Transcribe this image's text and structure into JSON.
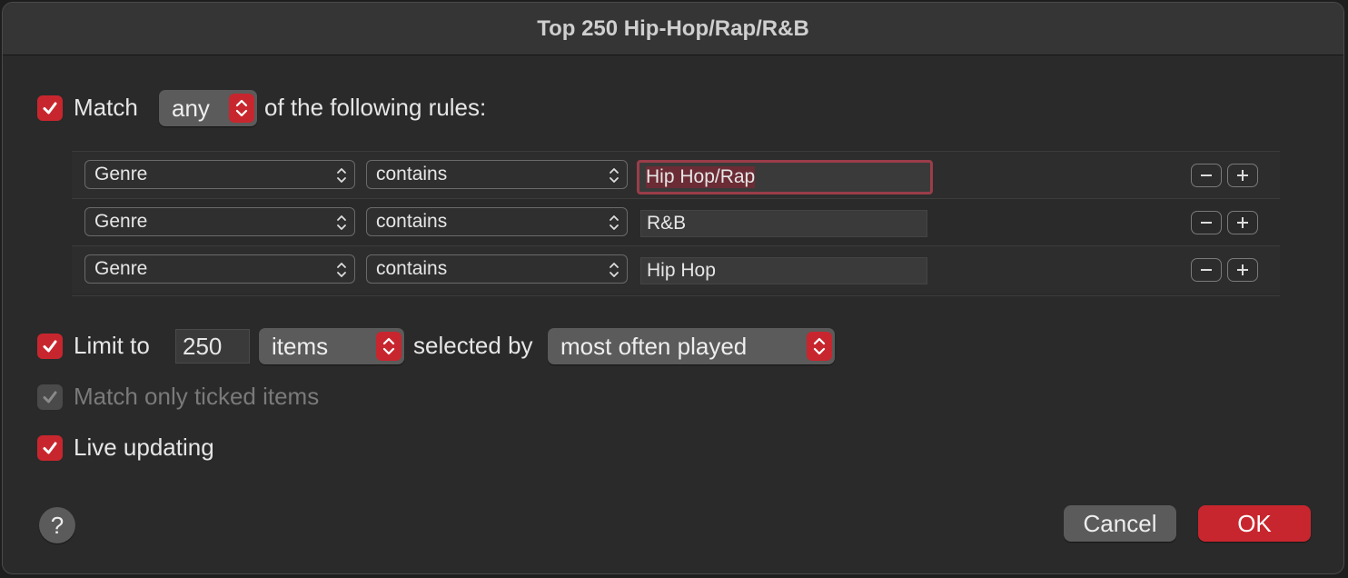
{
  "window": {
    "title": "Top 250 Hip-Hop/Rap/R&B"
  },
  "match": {
    "checked": true,
    "label": "Match",
    "mode": "any",
    "suffix": "of the following rules:"
  },
  "rules": [
    {
      "field": "Genre",
      "operator": "contains",
      "value": "Hip Hop/Rap",
      "focused": true
    },
    {
      "field": "Genre",
      "operator": "contains",
      "value": "R&B",
      "focused": false
    },
    {
      "field": "Genre",
      "operator": "contains",
      "value": "Hip Hop",
      "focused": false
    }
  ],
  "rule_buttons": {
    "remove": "−",
    "add": "+"
  },
  "limit": {
    "checked": true,
    "label": "Limit to",
    "count": "250",
    "unit": "items",
    "selected_by_label": "selected by",
    "selected_by": "most often played"
  },
  "match_ticked": {
    "checked": true,
    "enabled": false,
    "label": "Match only ticked items"
  },
  "live_updating": {
    "checked": true,
    "label": "Live updating"
  },
  "help": {
    "label": "?"
  },
  "buttons": {
    "cancel": "Cancel",
    "ok": "OK"
  },
  "colors": {
    "accent": "#c8262e",
    "background": "#2a2a2a",
    "control": "#5b5b5b"
  }
}
